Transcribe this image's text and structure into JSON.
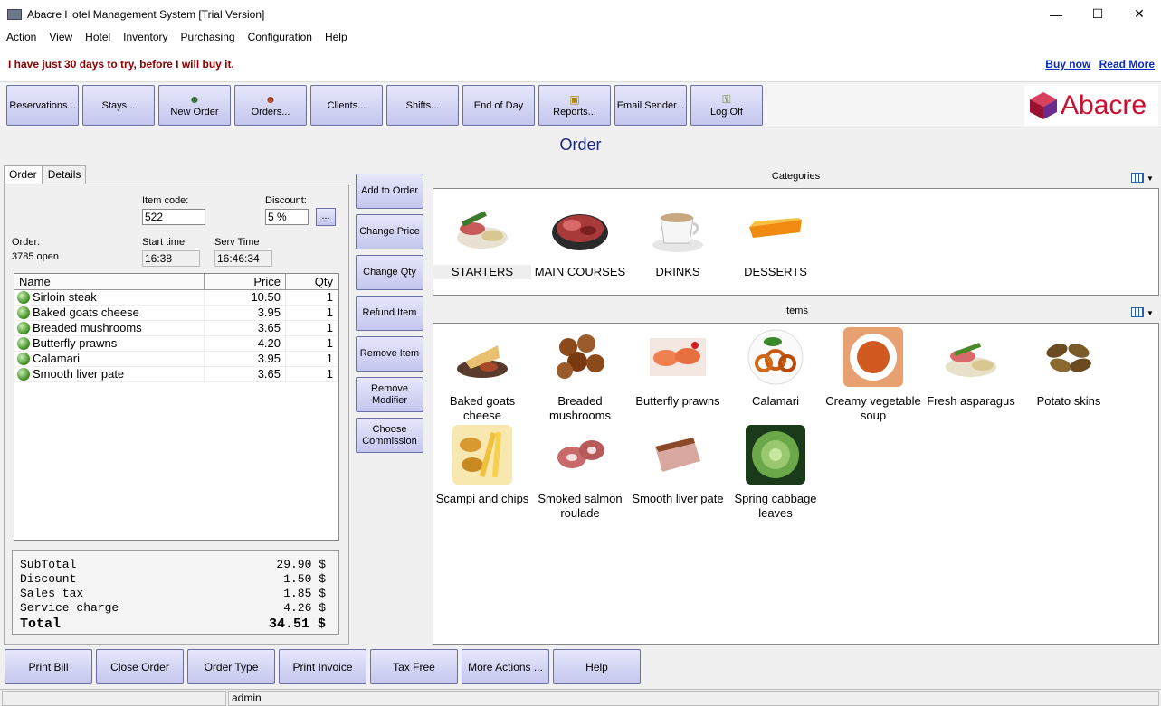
{
  "window": {
    "title": "Abacre Hotel Management System [Trial Version]"
  },
  "menu": [
    "Action",
    "View",
    "Hotel",
    "Inventory",
    "Purchasing",
    "Configuration",
    "Help"
  ],
  "trial": {
    "message": "I have just 30 days to try, before I will buy it.",
    "buy_now": "Buy now",
    "read_more": "Read More"
  },
  "toolbar": {
    "buttons": [
      "Reservations...",
      "Stays...",
      "New Order",
      "Orders...",
      "Clients...",
      "Shifts...",
      "End of Day",
      "Reports...",
      "Email Sender...",
      "Log Off"
    ]
  },
  "logo": {
    "text": "Abacre"
  },
  "page": {
    "title": "Order"
  },
  "tabs": [
    "Order",
    "Details"
  ],
  "order": {
    "item_code_label": "Item code:",
    "item_code_value": "522",
    "discount_label": "Discount:",
    "discount_value": "5 %",
    "dots": "...",
    "order_label": "Order:",
    "order_value": "3785 open",
    "start_time_label": "Start time",
    "start_time_value": "16:38",
    "serv_time_label": "Serv Time",
    "serv_time_value": "16:46:34"
  },
  "grid": {
    "columns": [
      "Name",
      "Price",
      "Qty"
    ],
    "rows": [
      {
        "name": "Sirloin steak",
        "price": "10.50",
        "qty": "1"
      },
      {
        "name": "Baked goats cheese",
        "price": "3.95",
        "qty": "1"
      },
      {
        "name": "Breaded mushrooms",
        "price": "3.65",
        "qty": "1"
      },
      {
        "name": "Butterfly prawns",
        "price": "4.20",
        "qty": "1"
      },
      {
        "name": "Calamari",
        "price": "3.95",
        "qty": "1"
      },
      {
        "name": "Smooth liver pate",
        "price": "3.65",
        "qty": "1"
      }
    ]
  },
  "totals": [
    {
      "label": "SubTotal",
      "value": "29.90 $"
    },
    {
      "label": "Discount",
      "value": "1.50 $"
    },
    {
      "label": "Sales tax",
      "value": "1.85 $"
    },
    {
      "label": "Service charge",
      "value": "4.26 $"
    },
    {
      "label": "Total",
      "value": "34.51 $"
    }
  ],
  "actions": [
    "Add to Order",
    "Change Price",
    "Change Qty",
    "Refund Item",
    "Remove Item",
    "Remove Modifier",
    "Choose Commission"
  ],
  "categories": {
    "header": "Categories",
    "items": [
      "STARTERS",
      "MAIN COURSES",
      "DRINKS",
      "DESSERTS"
    ]
  },
  "items": {
    "header": "Items",
    "list": [
      "Baked goats cheese",
      "Breaded mushrooms",
      "Butterfly prawns",
      "Calamari",
      "Creamy vegetable soup",
      "Fresh asparagus",
      "Potato skins",
      "Scampi and chips",
      "Smoked salmon roulade",
      "Smooth liver pate",
      "Spring cabbage leaves"
    ]
  },
  "bottom_buttons": [
    "Print Bill",
    "Close Order",
    "Order Type",
    "Print Invoice",
    "Tax Free",
    "More Actions ...",
    "Help"
  ],
  "status": {
    "user": "admin"
  },
  "colors": {
    "accent": "#1a237e",
    "button_top": "#e6e7fb",
    "button_bottom": "#c4c6ee",
    "trial_text": "#8b0000",
    "link": "#0a2bbd",
    "logo_red": "#c8102e"
  }
}
